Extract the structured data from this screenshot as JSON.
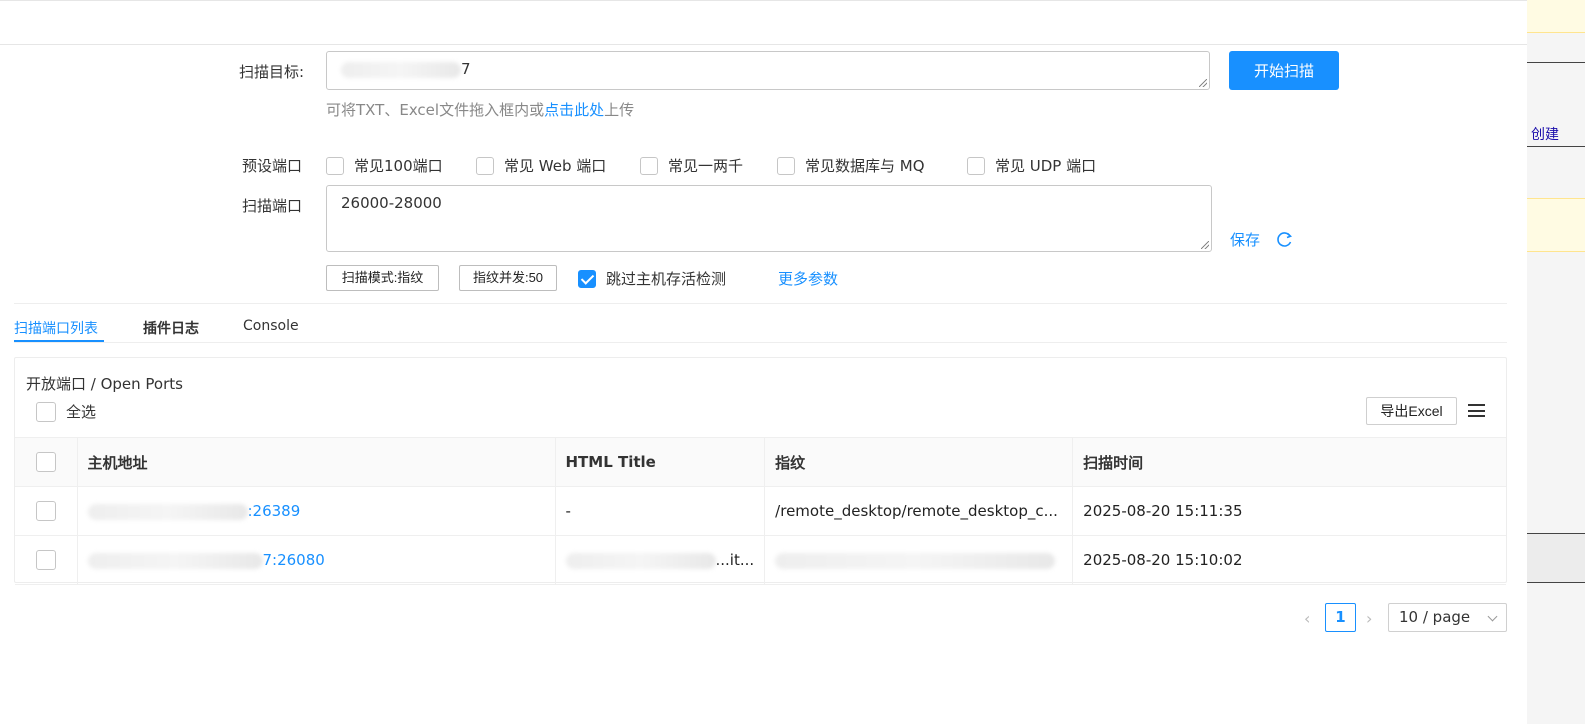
{
  "form": {
    "target_label": "扫描目标:",
    "target_value_suffix": "7",
    "start_button": "开始扫描",
    "hint_prefix": "可将TXT、Excel文件拖入框内或",
    "hint_link": "点击此处",
    "hint_suffix": "上传",
    "preset_label": "预设端口",
    "presets": [
      {
        "label": "常见100端口",
        "checked": false
      },
      {
        "label": "常见 Web 端口",
        "checked": false
      },
      {
        "label": "常见一两千",
        "checked": false
      },
      {
        "label": "常见数据库与 MQ",
        "checked": false
      },
      {
        "label": "常见 UDP 端口",
        "checked": false
      }
    ],
    "ports_label": "扫描端口",
    "ports_value": "26000-28000",
    "save_label": "保存",
    "scan_mode_button": "扫描模式:指纹",
    "concurrency_button": "指纹并发:50",
    "skip_alive_label": "跳过主机存活检测",
    "skip_alive_checked": true,
    "more_params": "更多参数"
  },
  "tabs": [
    {
      "label": "扫描端口列表",
      "active": true
    },
    {
      "label": "插件日志",
      "active": false
    },
    {
      "label": "Console",
      "active": false
    }
  ],
  "ports_card": {
    "title": "开放端口 / Open Ports",
    "select_all": "全选",
    "export_button": "导出Excel",
    "columns": [
      "主机地址",
      "HTML Title",
      "指纹",
      "扫描时间"
    ],
    "rows": [
      {
        "host_visible": ":26389",
        "title": "-",
        "fingerprint": "/remote_desktop/remote_desktop_c...",
        "time": "2025-08-20 15:11:35"
      },
      {
        "host_visible": "7:26080",
        "title": "...it...",
        "fingerprint": "",
        "time": "2025-08-20 15:10:02"
      }
    ]
  },
  "pagination": {
    "current_page": "1",
    "page_size": "10 / page"
  },
  "right_panel": {
    "link": "创建"
  },
  "colors": {
    "primary": "#1890ff",
    "border": "#c8c8c8",
    "panel_yellow": "#fffbe3"
  },
  "icons": [
    "refresh-icon",
    "menu-icon",
    "chevron-left-icon",
    "chevron-right-icon",
    "chevron-down-icon",
    "check-icon"
  ]
}
